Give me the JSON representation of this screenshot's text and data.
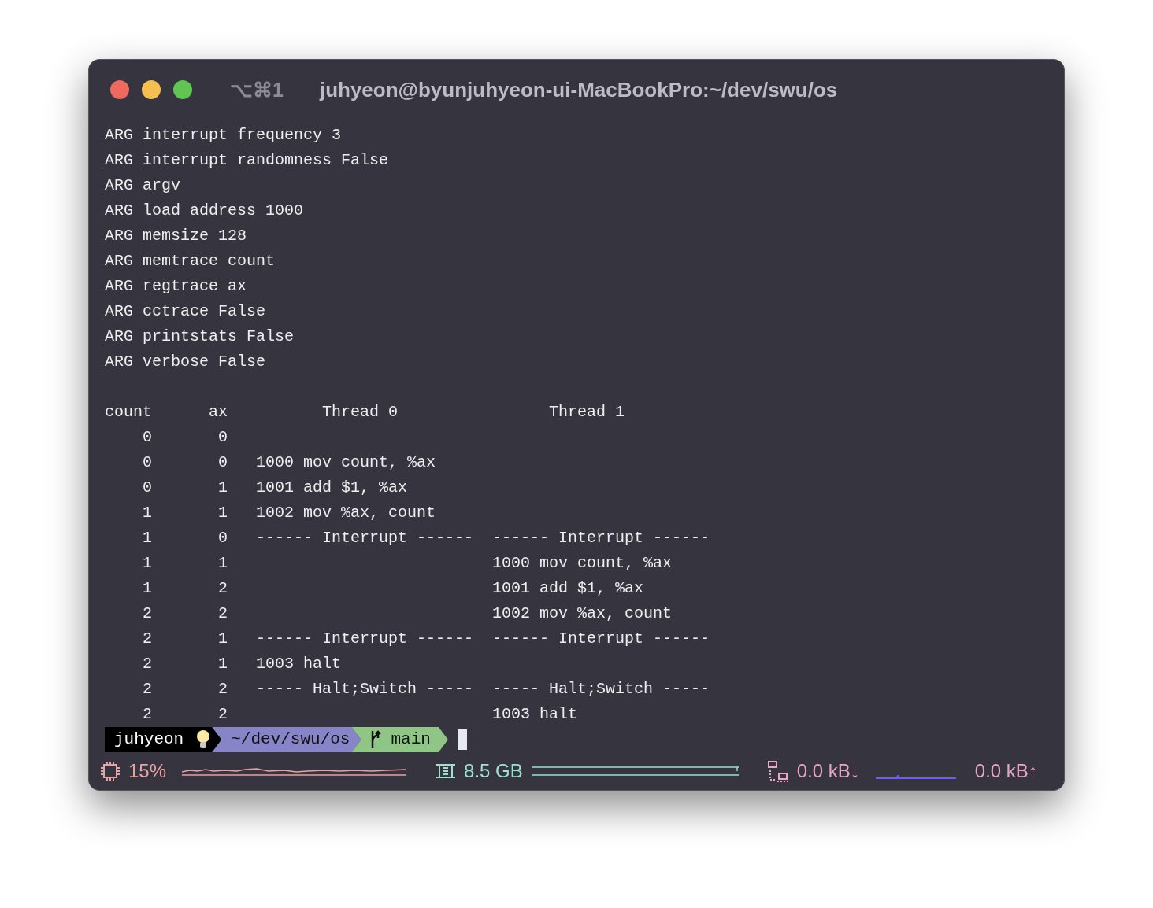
{
  "window": {
    "shortcut": "⌥⌘1",
    "title": "juhyeon@byunjuhyeon-ui-MacBookPro:~/dev/swu/os"
  },
  "output_lines": [
    "ARG interrupt frequency 3",
    "ARG interrupt randomness False",
    "ARG argv",
    "ARG load address 1000",
    "ARG memsize 128",
    "ARG memtrace count",
    "ARG regtrace ax",
    "ARG cctrace False",
    "ARG printstats False",
    "ARG verbose False"
  ],
  "table_lines": [
    "count      ax          Thread 0                Thread 1",
    "    0       0",
    "    0       0   1000 mov count, %ax",
    "    0       1   1001 add $1, %ax",
    "    1       1   1002 mov %ax, count",
    "    1       0   ------ Interrupt ------  ------ Interrupt ------",
    "    1       1                            1000 mov count, %ax",
    "    1       2                            1001 add $1, %ax",
    "    2       2                            1002 mov %ax, count",
    "    2       1   ------ Interrupt ------  ------ Interrupt ------",
    "    2       1   1003 halt",
    "    2       2   ----- Halt;Switch -----  ----- Halt;Switch -----",
    "    2       2                            1003 halt"
  ],
  "prompt": [
    {
      "kind": "user",
      "text": "juhyeon"
    },
    {
      "kind": "path",
      "text": "~/dev/swu/os"
    },
    {
      "kind": "git",
      "text": "main"
    }
  ],
  "status_bar": [
    {
      "kind": "cpu",
      "text": "15%"
    },
    {
      "kind": "memory",
      "text": "8.5 GB"
    },
    {
      "kind": "download",
      "text": "0.0 kB↓"
    },
    {
      "kind": "upload",
      "text": "0.0 kB↑"
    }
  ]
}
